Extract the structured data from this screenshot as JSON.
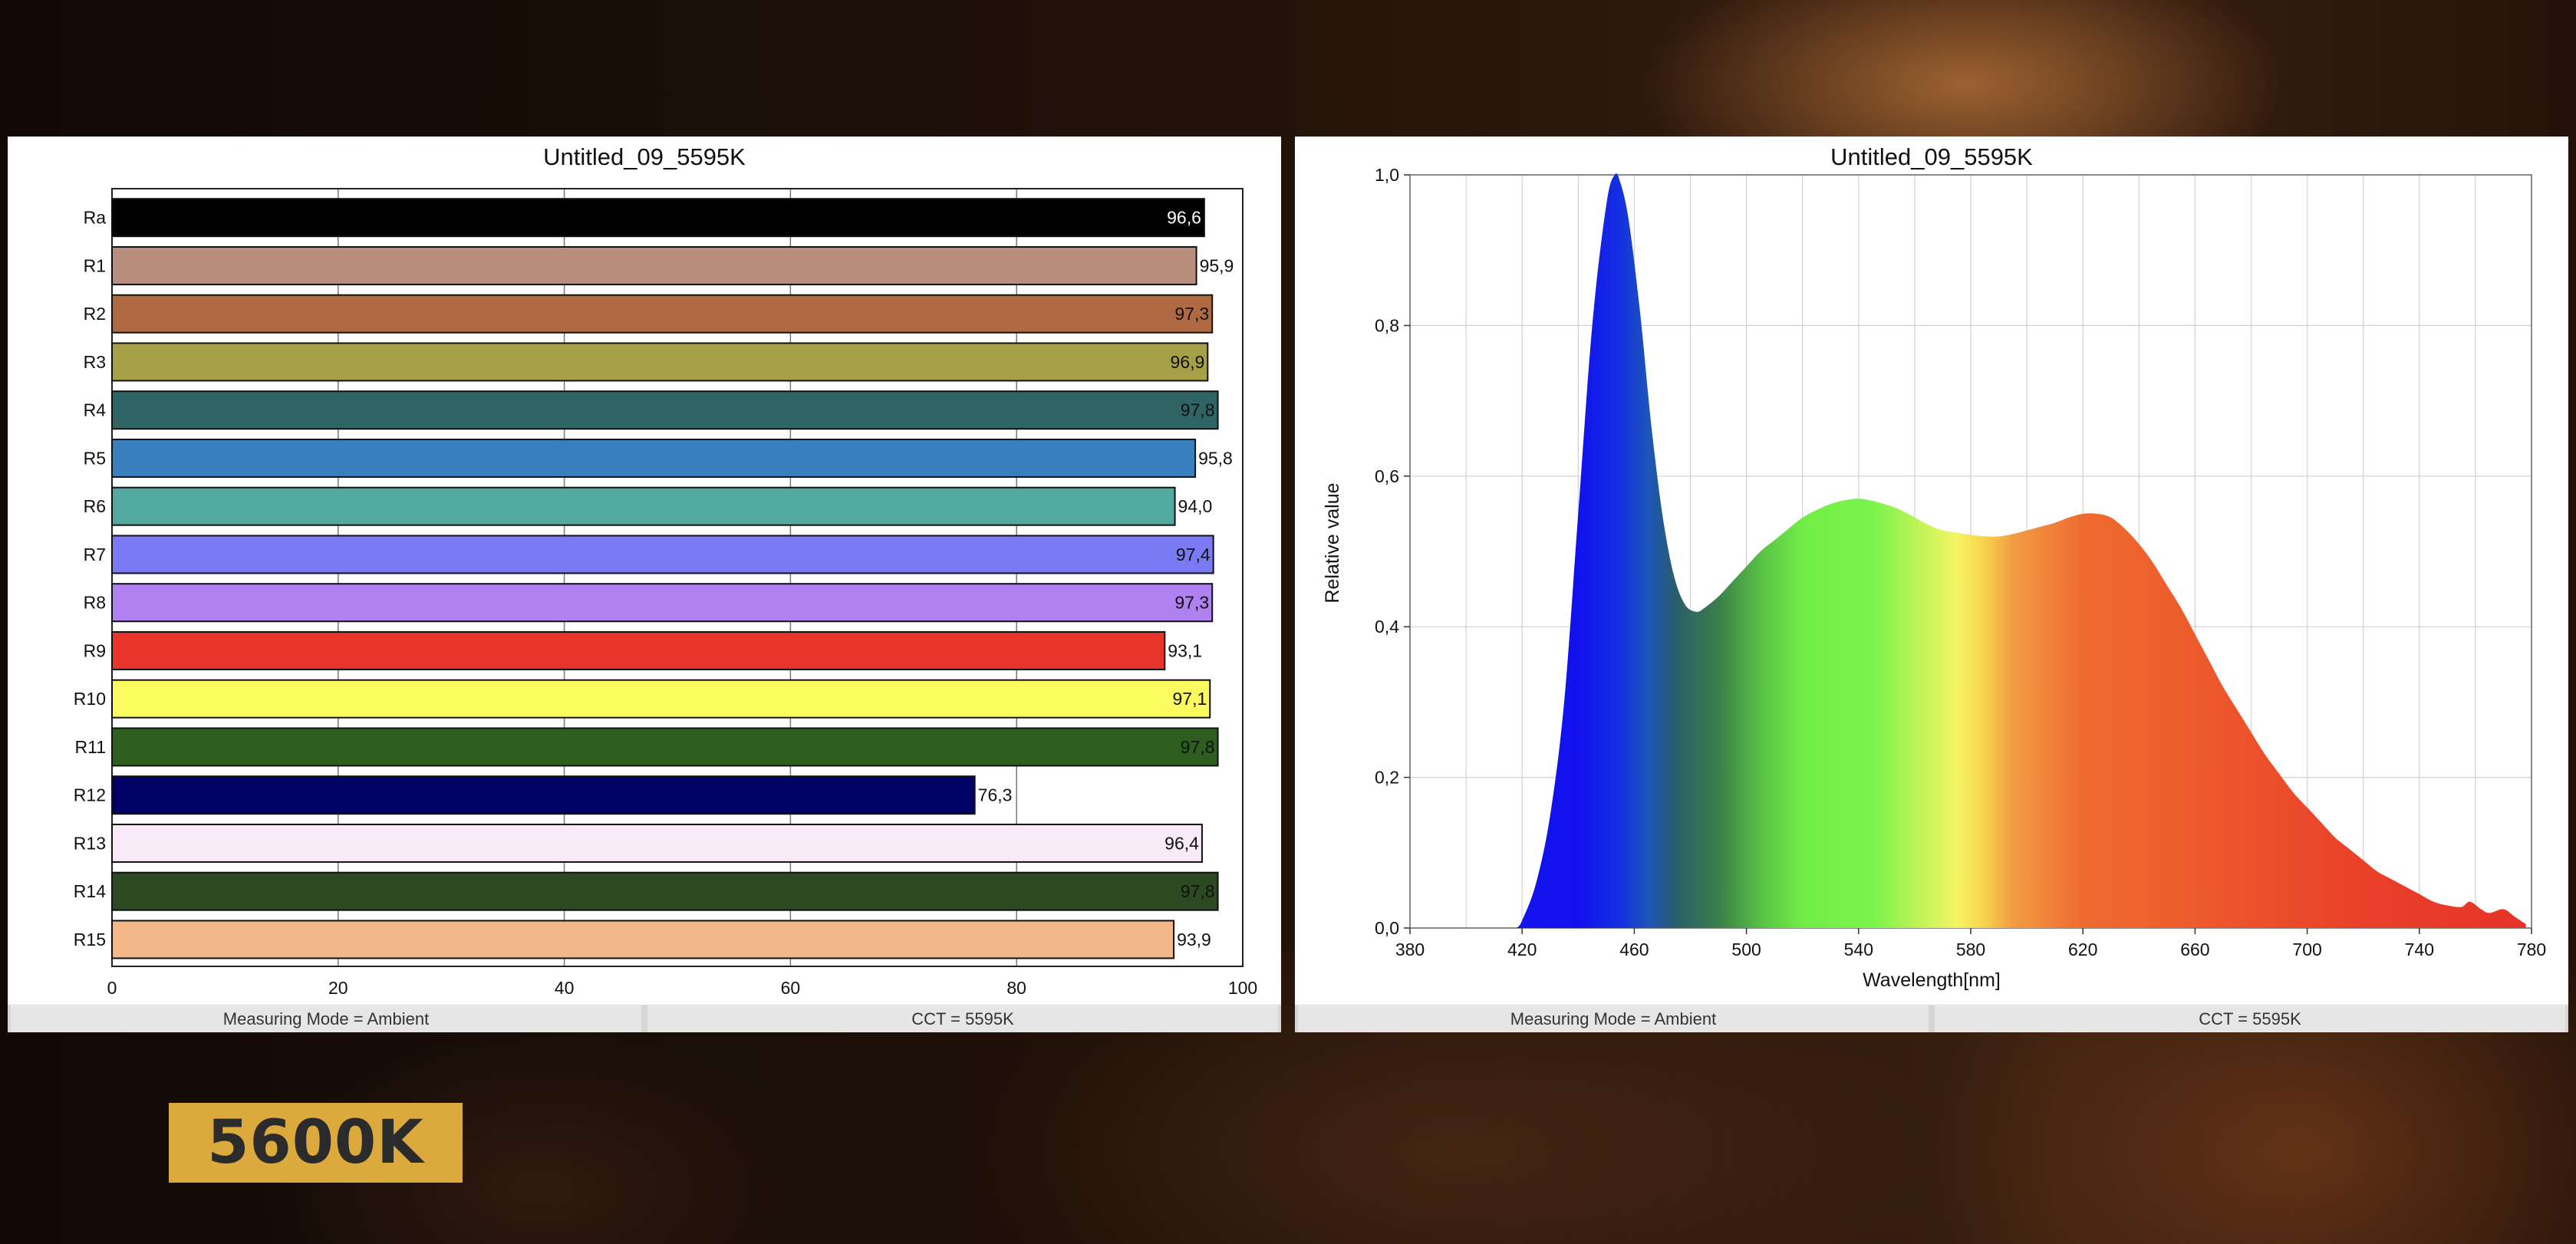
{
  "left_panel": {
    "status": {
      "mode": "Measuring Mode = Ambient",
      "cct": "CCT = 5595K"
    }
  },
  "right_panel": {
    "status": {
      "mode": "Measuring Mode = Ambient",
      "cct": "CCT = 5595K"
    }
  },
  "badge": {
    "text": "5600K",
    "color": "#dcaa3c"
  },
  "chart_data": [
    {
      "type": "bar",
      "orientation": "horizontal",
      "title": "Untitled_09_5595K",
      "xlim": [
        0,
        100
      ],
      "xticks": [
        "0",
        "20",
        "40",
        "60",
        "80",
        "100"
      ],
      "grid": true,
      "categories": [
        "Ra",
        "R1",
        "R2",
        "R3",
        "R4",
        "R5",
        "R6",
        "R7",
        "R8",
        "R9",
        "R10",
        "R11",
        "R12",
        "R13",
        "R14",
        "R15"
      ],
      "values": [
        96.6,
        95.9,
        97.3,
        96.9,
        97.8,
        95.8,
        94.0,
        97.4,
        97.3,
        93.1,
        97.1,
        97.8,
        76.3,
        96.4,
        97.8,
        93.9
      ],
      "value_labels": [
        "96,6",
        "95,9",
        "97,3",
        "96,9",
        "97,8",
        "95,8",
        "94,0",
        "97,4",
        "97,3",
        "93,1",
        "97,1",
        "97,8",
        "76,3",
        "96,4",
        "97,8",
        "93,9"
      ],
      "colors": [
        "#000000",
        "#b88e7e",
        "#b06a43",
        "#a6a046",
        "#2f6464",
        "#3a7fbd",
        "#52aa9e",
        "#7b7af5",
        "#ae80f0",
        "#e8352c",
        "#fbfb60",
        "#2d5e1f",
        "#000066",
        "#f9eaf8",
        "#2b4a22",
        "#f4b888"
      ],
      "label_inside": [
        true,
        false,
        true,
        true,
        true,
        false,
        false,
        true,
        true,
        false,
        true,
        true,
        false,
        true,
        true,
        false
      ]
    },
    {
      "type": "area",
      "title": "Untitled_09_5595K",
      "xlabel": "Wavelength[nm]",
      "ylabel": "Relative value",
      "xlim": [
        380,
        780
      ],
      "ylim": [
        0,
        1
      ],
      "xticks": [
        "380",
        "420",
        "460",
        "500",
        "540",
        "580",
        "620",
        "660",
        "700",
        "740",
        "780"
      ],
      "yticks": [
        "0,0",
        "0,2",
        "0,4",
        "0,6",
        "0,8",
        "1,0"
      ],
      "grid": true,
      "fill": "visible spectrum gradient",
      "x": [
        418,
        420,
        425,
        430,
        435,
        440,
        445,
        450,
        453,
        455,
        458,
        462,
        466,
        470,
        474,
        478,
        482,
        485,
        490,
        495,
        500,
        505,
        510,
        515,
        520,
        525,
        530,
        535,
        540,
        545,
        550,
        555,
        560,
        565,
        570,
        575,
        580,
        585,
        590,
        595,
        600,
        605,
        610,
        615,
        620,
        625,
        630,
        635,
        640,
        645,
        650,
        655,
        660,
        665,
        670,
        675,
        680,
        685,
        690,
        695,
        700,
        705,
        710,
        715,
        720,
        725,
        730,
        735,
        740,
        745,
        750,
        755,
        758,
        762,
        765,
        770,
        774,
        778
      ],
      "y": [
        0.0,
        0.01,
        0.06,
        0.15,
        0.3,
        0.55,
        0.8,
        0.96,
        1.0,
        0.99,
        0.94,
        0.82,
        0.67,
        0.55,
        0.47,
        0.43,
        0.42,
        0.425,
        0.44,
        0.46,
        0.48,
        0.5,
        0.515,
        0.53,
        0.545,
        0.555,
        0.563,
        0.568,
        0.57,
        0.567,
        0.562,
        0.555,
        0.545,
        0.535,
        0.528,
        0.525,
        0.522,
        0.52,
        0.52,
        0.523,
        0.528,
        0.533,
        0.538,
        0.545,
        0.55,
        0.55,
        0.545,
        0.53,
        0.51,
        0.485,
        0.455,
        0.425,
        0.39,
        0.355,
        0.32,
        0.29,
        0.26,
        0.23,
        0.205,
        0.18,
        0.16,
        0.14,
        0.12,
        0.105,
        0.09,
        0.075,
        0.065,
        0.055,
        0.045,
        0.035,
        0.03,
        0.028,
        0.035,
        0.025,
        0.02,
        0.025,
        0.015,
        0.005
      ]
    }
  ]
}
